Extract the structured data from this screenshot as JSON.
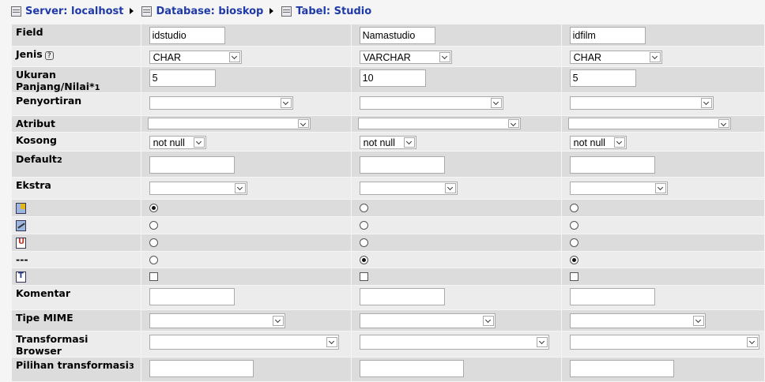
{
  "breadcrumb": {
    "server": "Server: localhost",
    "database": "Database: bioskop",
    "table": "Tabel: Studio"
  },
  "labels": {
    "field": "Field",
    "jenis": "Jenis",
    "ukuran": "Ukuran Panjang/Nilai*",
    "ukuran_sup": "1",
    "penyortiran": "Penyortiran",
    "atribut": "Atribut",
    "kosong": "Kosong",
    "default": "Default",
    "default_sup": "2",
    "ekstra": "Ekstra",
    "no_index": "---",
    "komentar": "Komentar",
    "tipe_mime": "Tipe MIME",
    "transformasi": "Transformasi Browser",
    "pilihan": "Pilihan transformasi",
    "pilihan_sup": "3"
  },
  "icons": {
    "help": "?",
    "unique_glyph": "U",
    "fulltext_glyph": "T"
  },
  "columns": [
    {
      "field": "idstudio",
      "type": "CHAR",
      "length": "5",
      "null": "not null",
      "default": "",
      "key": "primary",
      "fulltext": false
    },
    {
      "field": "Namastudio",
      "type": "VARCHAR",
      "length": "10",
      "null": "not null",
      "default": "",
      "key": "none",
      "fulltext": false
    },
    {
      "field": "idfilm",
      "type": "CHAR",
      "length": "5",
      "null": "not null",
      "default": "",
      "key": "none",
      "fulltext": false
    }
  ]
}
